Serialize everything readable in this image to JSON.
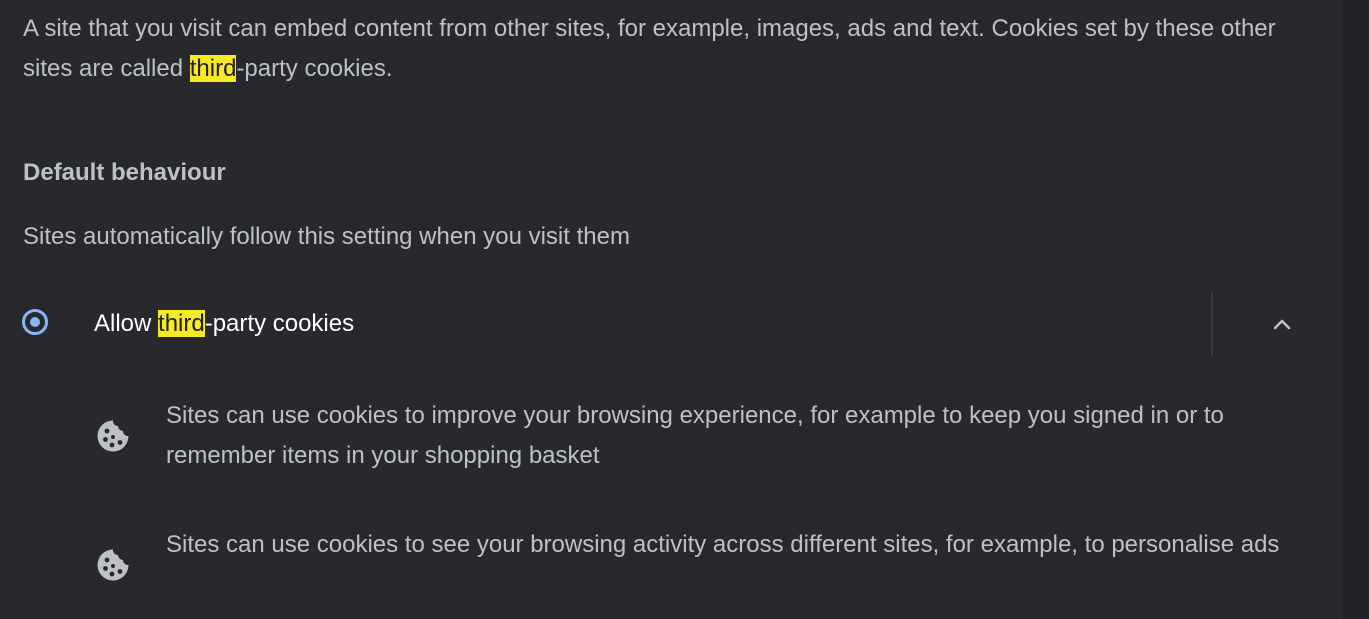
{
  "intro": {
    "part1": "A site that you visit can embed content from other sites, for example, images, ads and text. Cookies set by these other sites are called ",
    "highlight": "third",
    "part2": "-party cookies."
  },
  "default_behaviour": {
    "heading": "Default behaviour",
    "subtitle": "Sites automatically follow this setting when you visit them"
  },
  "option": {
    "label_prefix": "Allow ",
    "label_highlight": "third",
    "label_suffix": "-party cookies",
    "selected": true,
    "expanded": true
  },
  "bullets": [
    {
      "icon": "cookie-icon",
      "text": "Sites can use cookies to improve your browsing experience, for example to keep you signed in or to remember items in your shopping basket"
    },
    {
      "icon": "cookie-icon",
      "text": "Sites can use cookies to see your browsing activity across different sites, for example, to personalise ads"
    }
  ],
  "colors": {
    "background": "#28292c",
    "accent": "#8ab4f8",
    "highlight": "#f6e926"
  }
}
